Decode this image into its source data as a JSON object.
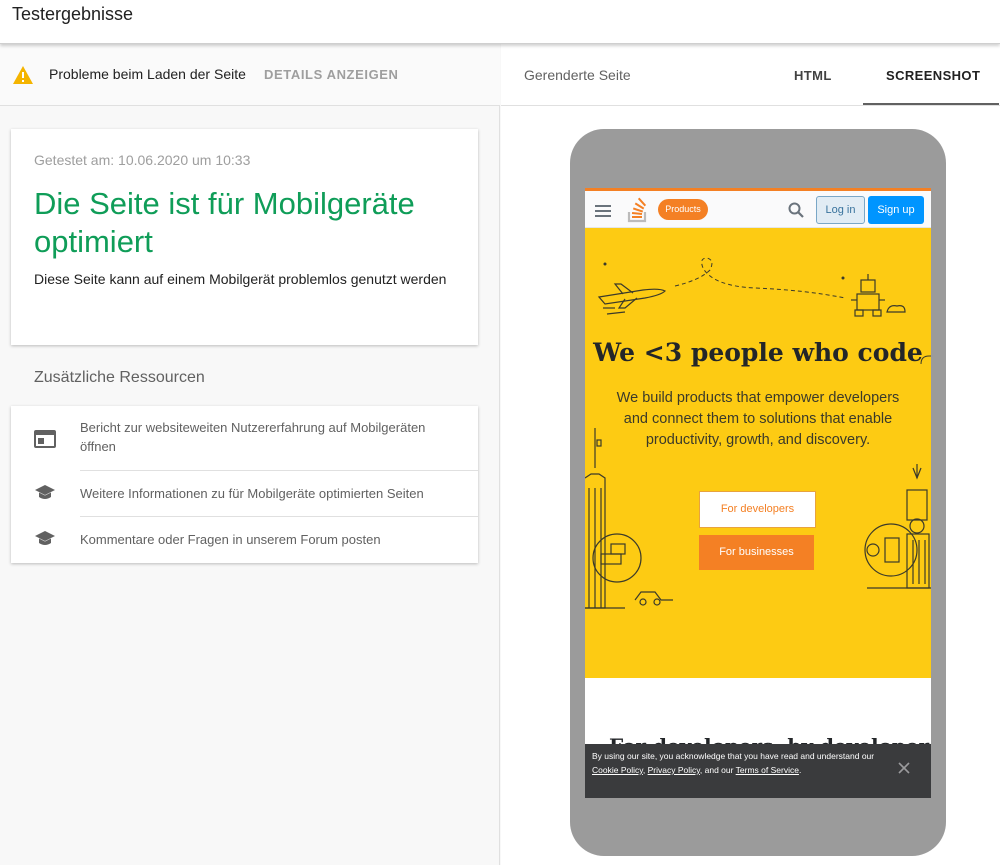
{
  "header": {
    "title": "Testergebnisse"
  },
  "status_bar": {
    "message": "Probleme beim Laden der Seite",
    "details_link": "DETAILS ANZEIGEN"
  },
  "result": {
    "tested_at": "Getestet am: 10.06.2020 um 10:33",
    "verdict": "Die Seite ist für Mobilgeräte optimiert",
    "description": "Diese Seite kann auf einem Mobilgerät problemlos genutzt werden",
    "verdict_color": "#0f9d58"
  },
  "resources": {
    "heading": "Zusätzliche Ressourcen",
    "items": [
      {
        "icon": "browser-window-icon",
        "label": "Bericht zur websiteweiten Nutzererfahrung auf Mobilgeräten öffnen"
      },
      {
        "icon": "graduation-cap-icon",
        "label": "Weitere Informationen zu für Mobilgeräte optimierten Seiten"
      },
      {
        "icon": "graduation-cap-icon",
        "label": "Kommentare oder Fragen in unserem Forum posten"
      }
    ]
  },
  "preview": {
    "title": "Gerenderte Seite",
    "tabs": [
      {
        "label": "HTML",
        "active": false
      },
      {
        "label": "SCREENSHOT",
        "active": true
      }
    ]
  },
  "rendered_site": {
    "nav": {
      "products_label": "Products",
      "login_label": "Log in",
      "signup_label": "Sign up"
    },
    "hero": {
      "heading": "We <3 people who code",
      "text": "We build products that empower developers and connect them to solutions that enable productivity, growth, and discovery.",
      "developers_button": "For developers",
      "businesses_button": "For businesses",
      "background_color": "#fdcb13"
    },
    "section_heading": "For developers, by developers",
    "cookie_banner": {
      "text_before": "By using our site, you acknowledge that you have read and understand our ",
      "cookie_policy": "Cookie Policy",
      "sep1": ", ",
      "privacy_policy": "Privacy Policy",
      "sep2": ", and our ",
      "terms": "Terms of Service",
      "text_after": "."
    }
  }
}
